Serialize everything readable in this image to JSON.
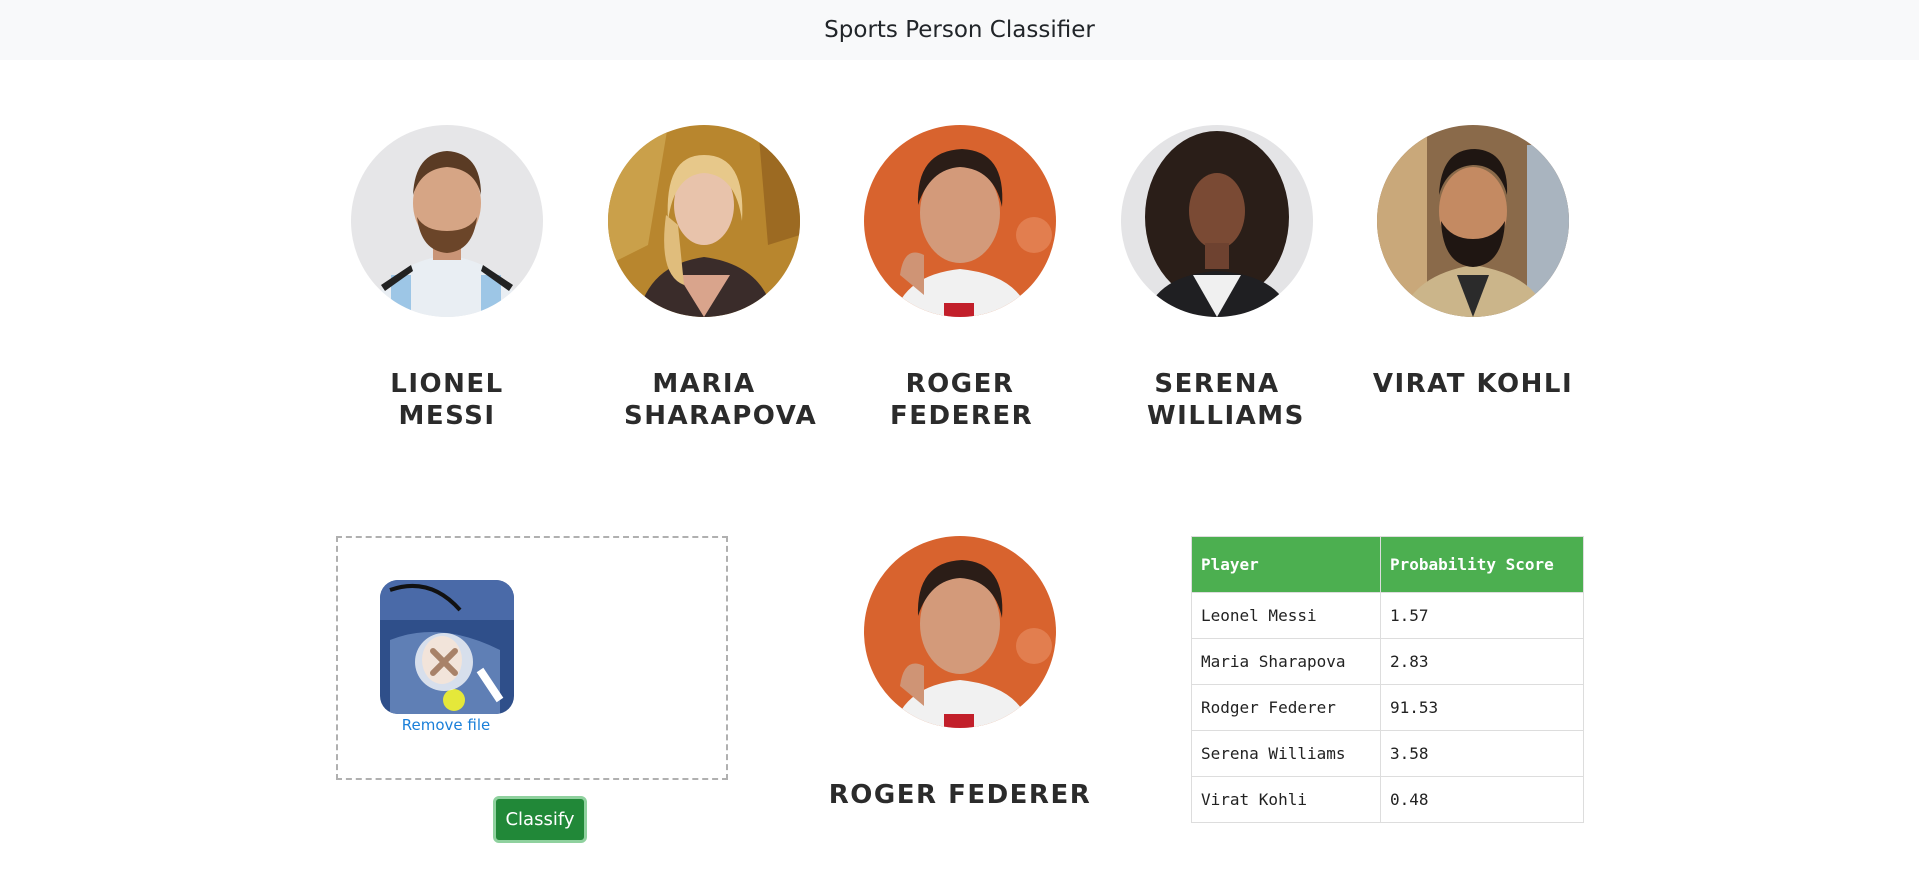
{
  "navbar": {
    "title": "Sports Person Classifier"
  },
  "players": [
    {
      "name": "Lionel Messi"
    },
    {
      "name": "Maria Sharapova"
    },
    {
      "name": "Roger Federer"
    },
    {
      "name": "Serena Williams"
    },
    {
      "name": "Virat Kohli"
    }
  ],
  "upload": {
    "remove_label": "Remove file",
    "classify_label": "Classify"
  },
  "result": {
    "name": "ROGER FEDERER"
  },
  "table": {
    "headers": [
      "Player",
      "Probability Score"
    ],
    "rows": [
      [
        "Leonel Messi",
        "1.57"
      ],
      [
        "Maria Sharapova",
        "2.83"
      ],
      [
        "Rodger Federer",
        "91.53"
      ],
      [
        "Serena Williams",
        "3.58"
      ],
      [
        "Virat Kohli",
        "0.48"
      ]
    ]
  },
  "colors": {
    "table_header": "#4caf50",
    "button": "#218838",
    "link": "#1a7fd9",
    "navbar_bg": "#f8f9fa"
  }
}
